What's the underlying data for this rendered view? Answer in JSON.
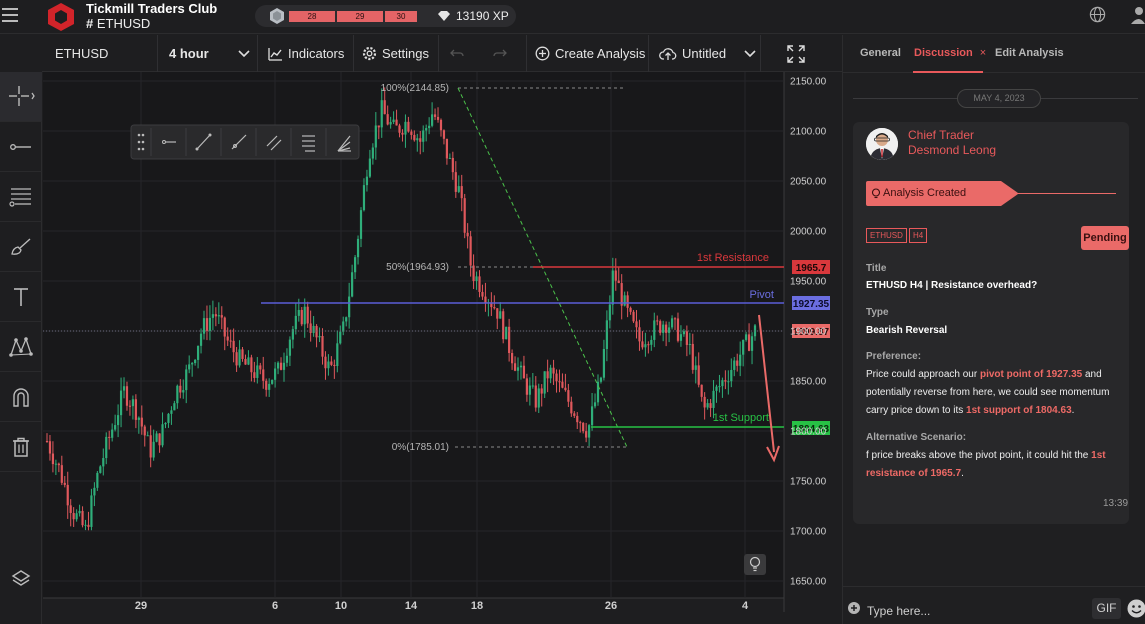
{
  "header": {
    "club_name": "Tickmill Traders Club",
    "room_name": "ETHUSD",
    "levels": [
      "28",
      "29",
      "30"
    ],
    "xp": "13190 XP",
    "colors": {
      "accent": "#e8595b",
      "level_bar": "#e46466"
    }
  },
  "toolbar": {
    "symbol": "ETHUSD",
    "interval": "4 hour",
    "indicators": "Indicators",
    "settings": "Settings",
    "create_analysis": "Create Analysis",
    "untitled": "Untitled"
  },
  "left_tools": [
    "crosshair-icon",
    "horizontal-line-icon",
    "fib-tool-icon",
    "brush-icon",
    "text-tool-icon",
    "pattern-icon",
    "magnet-icon",
    "trash-icon",
    "layers-icon"
  ],
  "chart": {
    "price_labels": [
      "2150.00",
      "2100.00",
      "2050.00",
      "2000.00",
      "1950.00",
      "1900.00",
      "1850.00",
      "1800.00",
      "1750.00",
      "1700.00",
      "1650.00"
    ],
    "date_labels": [
      "29",
      "6",
      "10",
      "14",
      "18",
      "26",
      "4"
    ],
    "fib_100": "100%(2144.85)",
    "fib_50": "50%(1964.93)",
    "fib_0": "0%(1785.01)",
    "resistance_label": "1st Resistance",
    "pivot_label": "Pivot",
    "support_label": "1st Support",
    "resistance_price": "1965.7",
    "pivot_price": "1927.35",
    "current_price": "1899.87",
    "support_price": "1804.63"
  },
  "chart_data": {
    "type": "candlestick",
    "symbol": "ETHUSD",
    "interval": "4 hour",
    "ylim": [
      1650,
      2150
    ],
    "x_ticks": [
      "29",
      "6",
      "10",
      "14",
      "18",
      "26",
      "4"
    ],
    "levels": [
      {
        "name": "1st Resistance",
        "value": 1965.7,
        "color": "#d9383c"
      },
      {
        "name": "Pivot",
        "value": 1927.35,
        "color": "#5a5ed8"
      },
      {
        "name": "1st Support",
        "value": 1804.63,
        "color": "#27c145"
      }
    ],
    "current_price": 1899.87,
    "fibonacci": [
      {
        "level": "100%",
        "value": 2144.85
      },
      {
        "level": "50%",
        "value": 1964.93
      },
      {
        "level": "0%",
        "value": 1785.01
      }
    ],
    "close_path": [
      1790,
      1760,
      1720,
      1700,
      1760,
      1800,
      1840,
      1820,
      1780,
      1800,
      1840,
      1860,
      1900,
      1920,
      1890,
      1870,
      1860,
      1850,
      1860,
      1900,
      1920,
      1890,
      1860,
      1900,
      1980,
      2080,
      2120,
      2100,
      2110,
      2090,
      2120,
      2080,
      2040,
      1960,
      1940,
      1920,
      1880,
      1850,
      1830,
      1860,
      1840,
      1820,
      1800,
      1850,
      1960,
      1920,
      1890,
      1900,
      1910,
      1900,
      1880,
      1820,
      1840,
      1860,
      1880,
      1900
    ]
  },
  "panel": {
    "tabs": [
      "General",
      "Discussion",
      "Edit Analysis"
    ],
    "date": "MAY 4, 2023",
    "role": "Chief Trader",
    "author": "Desmond Leong",
    "banner": "Analysis Created",
    "tags": [
      "ETHUSD",
      "H4"
    ],
    "status": "Pending",
    "title_label": "Title",
    "title": "ETHUSD H4 | Resistance overhead?",
    "type_label": "Type",
    "type": "Bearish Reversal",
    "preference_label": "Preference:",
    "preference": {
      "p1": "Price could approach our ",
      "h1": "pivot point of 1927.35",
      "p2": " and potentially reverse from here, we could see momentum carry price down to its ",
      "h2": "1st support of 1804.63",
      "p3": "."
    },
    "alt_label": "Alternative Scenario:",
    "alternative": {
      "p1": "f price breaks above the pivot point, it could hit the ",
      "h1": "1st resistance of 1965.7",
      "p2": "."
    },
    "time": "13:39",
    "input_placeholder": "Type here...",
    "gif": "GIF"
  }
}
